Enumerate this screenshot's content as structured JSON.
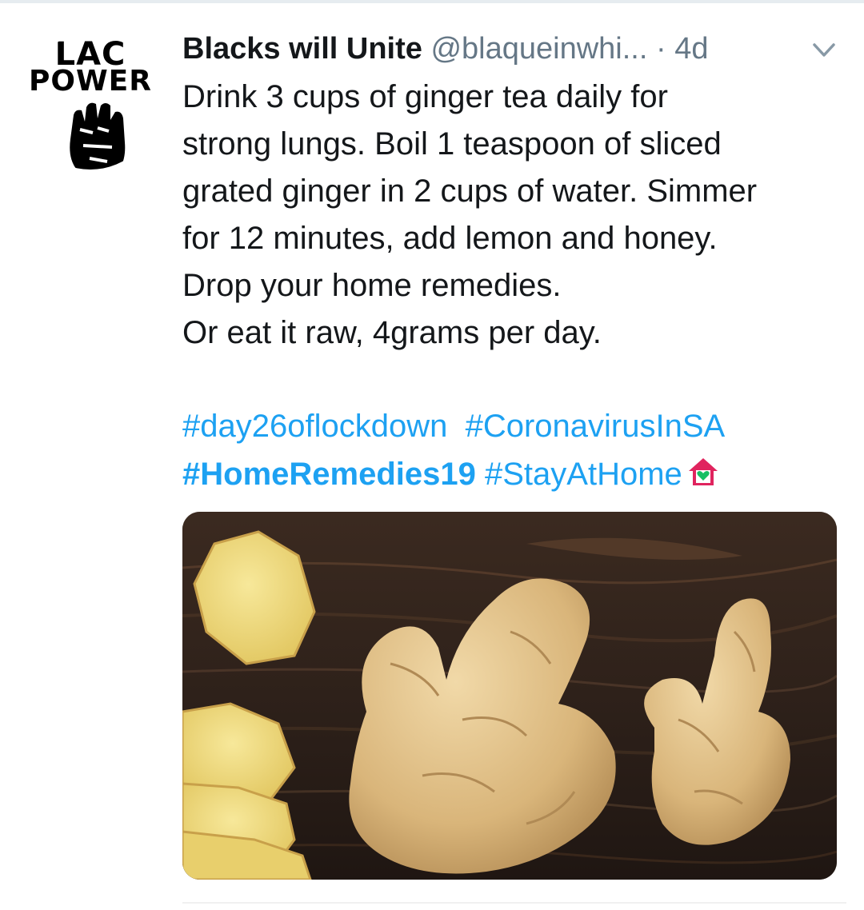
{
  "tweet": {
    "avatar": {
      "line1": "LAC",
      "line2": "POWER",
      "icon": "raised-fist-icon"
    },
    "display_name": "Blacks will Unite",
    "handle": "@blaqueinwhi...",
    "separator": "·",
    "time": "4d",
    "menu_icon": "chevron-down-icon",
    "body_lines": [
      "Drink 3 cups of ginger tea daily for",
      "strong lungs. Boil 1 teaspoon of sliced",
      "grated ginger in 2 cups of water. Simmer",
      "for 12 minutes, add lemon and honey.",
      "Drop your home remedies.",
      "Or eat it raw, 4grams per day."
    ],
    "hashtags": [
      [
        "#day26oflockdown",
        "#CoronavirusInSA"
      ],
      [
        "#HomeRemedies19",
        "#StayAtHome"
      ]
    ],
    "emoji": "house-with-heart-icon",
    "image_alt": "ginger-root-photo",
    "colors": {
      "link": "#1da1f2",
      "muted": "#657786",
      "text": "#14171a"
    }
  }
}
